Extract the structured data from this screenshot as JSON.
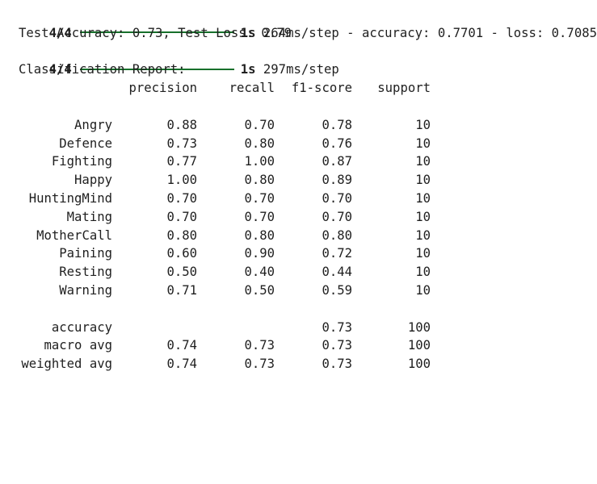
{
  "progress_lines": [
    {
      "steps": "4/4",
      "progress": 1.0,
      "time": "1s",
      "detail": " 264ms/step - accuracy: 0.7701 - loss: 0.7085"
    },
    {
      "steps": "4/4",
      "progress": 1.0,
      "time": "1s",
      "detail": " 297ms/step"
    }
  ],
  "test_result": "Test Accuracy: 0.73, Test Loss: 0.79",
  "report": {
    "title": "Classification Report:",
    "headers": [
      "precision",
      "recall",
      "f1-score",
      "support"
    ],
    "rows": [
      {
        "label": "Angry",
        "precision": "0.88",
        "recall": "0.70",
        "f1": "0.78",
        "support": "10"
      },
      {
        "label": "Defence",
        "precision": "0.73",
        "recall": "0.80",
        "f1": "0.76",
        "support": "10"
      },
      {
        "label": "Fighting",
        "precision": "0.77",
        "recall": "1.00",
        "f1": "0.87",
        "support": "10"
      },
      {
        "label": "Happy",
        "precision": "1.00",
        "recall": "0.80",
        "f1": "0.89",
        "support": "10"
      },
      {
        "label": "HuntingMind",
        "precision": "0.70",
        "recall": "0.70",
        "f1": "0.70",
        "support": "10"
      },
      {
        "label": "Mating",
        "precision": "0.70",
        "recall": "0.70",
        "f1": "0.70",
        "support": "10"
      },
      {
        "label": "MotherCall",
        "precision": "0.80",
        "recall": "0.80",
        "f1": "0.80",
        "support": "10"
      },
      {
        "label": "Paining",
        "precision": "0.60",
        "recall": "0.90",
        "f1": "0.72",
        "support": "10"
      },
      {
        "label": "Resting",
        "precision": "0.50",
        "recall": "0.40",
        "f1": "0.44",
        "support": "10"
      },
      {
        "label": "Warning",
        "precision": "0.71",
        "recall": "0.50",
        "f1": "0.59",
        "support": "10"
      }
    ],
    "summary": [
      {
        "label": "accuracy",
        "precision": "",
        "recall": "",
        "f1": "0.73",
        "support": "100"
      },
      {
        "label": "macro avg",
        "precision": "0.74",
        "recall": "0.73",
        "f1": "0.73",
        "support": "100"
      },
      {
        "label": "weighted avg",
        "precision": "0.74",
        "recall": "0.73",
        "f1": "0.73",
        "support": "100"
      }
    ]
  },
  "colors": {
    "progress_bar": "#17702b",
    "text": "#1f1f1f",
    "background": "#ffffff"
  }
}
